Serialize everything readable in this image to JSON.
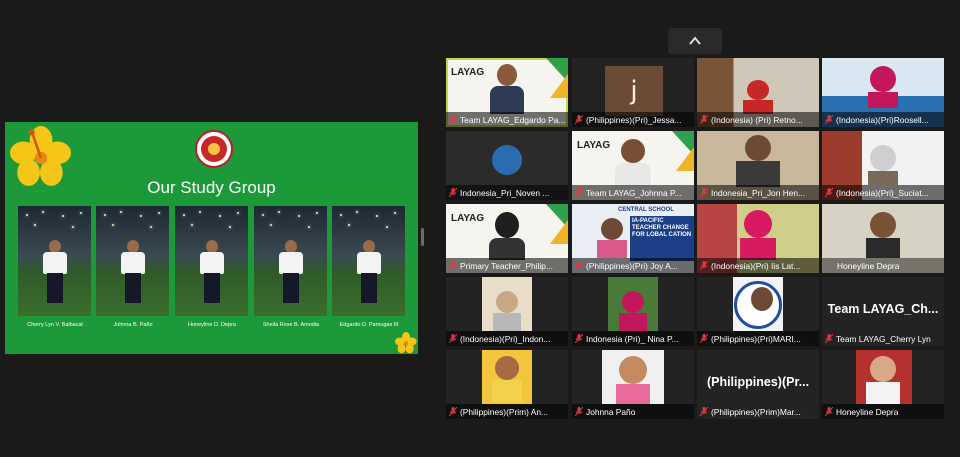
{
  "slide": {
    "title": "Our Study Group",
    "members": [
      {
        "name": "Cherry Lyn V. Balbacal"
      },
      {
        "name": "Johnna B. Paño"
      },
      {
        "name": "Honeyline D. Depra"
      },
      {
        "name": "Sheila Rose B. Amodia"
      },
      {
        "name": "Edgardo D. Pamugas III"
      }
    ]
  },
  "participants": [
    {
      "name": "Team LAYAG_Edgardo Pa...",
      "active": true
    },
    {
      "name": "(Philippines)(Pri)_Jessa...",
      "initial": "j"
    },
    {
      "name": "(Indonesia) (Pri) Retno..."
    },
    {
      "name": "(Indonesia)(Pri)Roosell..."
    },
    {
      "name": "Indonesia_Pri_Noven ..."
    },
    {
      "name": "Team LAYAG_Johnna P..."
    },
    {
      "name": "Indonesia_Pri_Jon Hen..."
    },
    {
      "name": "(Indonesia)(Pri)_Suciat..."
    },
    {
      "name": "Primary Teacher_Philip..."
    },
    {
      "name": "(Philippines)(Pri) Joy A..."
    },
    {
      "name": "(Indonesia)(Pri) Iis Lat..."
    },
    {
      "name": "Honeyline Depra"
    },
    {
      "name": "(Indonesia)(Pri)_Indon..."
    },
    {
      "name": "Indonesia (Pri)_ Nina P..."
    },
    {
      "name": "(Philippines)(Pri)MARI..."
    },
    {
      "name": "Team LAYAG_Cherry Lyn",
      "big_text": "Team LAYAG_Ch..."
    },
    {
      "name": "(Philippines)(Prim) An..."
    },
    {
      "name": "Johnna Paño"
    },
    {
      "name": "(Philippines)(Prim)Mar...",
      "big_text": "(Philippines)(Pr..."
    },
    {
      "name": "Honeyline Depra"
    }
  ],
  "tile_texts": {
    "layag": "LAYAG",
    "central_school": "CENTRAL SCHOOL",
    "asia_pacific": "IA-PACIFIC TEACHER CHANGE FOR LOBAL CATION"
  },
  "icons": {
    "mic": "mic-muted-icon",
    "scroll": "chevron-up-icon"
  },
  "colors": {
    "slide_bg": "#1c9a3a",
    "active_border": "#c4d94a",
    "muted_icon": "#e0393e",
    "background": "#1a1a1a"
  }
}
